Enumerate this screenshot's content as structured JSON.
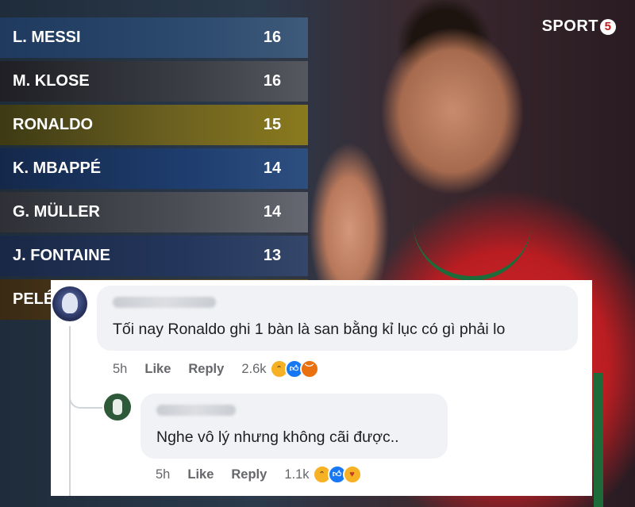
{
  "logo": {
    "text": "SPORT",
    "badge": "5"
  },
  "ranking": [
    {
      "name": "L. MESSI",
      "value": "16"
    },
    {
      "name": "M. KLOSE",
      "value": "16"
    },
    {
      "name": "RONALDO",
      "value": "15"
    },
    {
      "name": "K. MBAPPÉ",
      "value": "14"
    },
    {
      "name": "G. MÜLLER",
      "value": "14"
    },
    {
      "name": "J. FONTAINE",
      "value": "13"
    },
    {
      "name": "PELÉ",
      "value": ""
    }
  ],
  "comments": [
    {
      "text": "Tối nay Ronaldo ghi 1 bàn là san bằng kỉ lục có gì phải lo",
      "time": "5h",
      "like": "Like",
      "reply": "Reply",
      "reactions": "2.6k",
      "reaction_icons": [
        "haha",
        "like",
        "angry"
      ]
    },
    {
      "text": "Nghe vô lý nhưng không cãi được..",
      "time": "5h",
      "like": "Like",
      "reply": "Reply",
      "reactions": "1.1k",
      "reaction_icons": [
        "haha",
        "like",
        "care"
      ]
    }
  ],
  "colors": {
    "facebook_blue": "#1877f2",
    "portugal_red": "#d92b2b"
  }
}
